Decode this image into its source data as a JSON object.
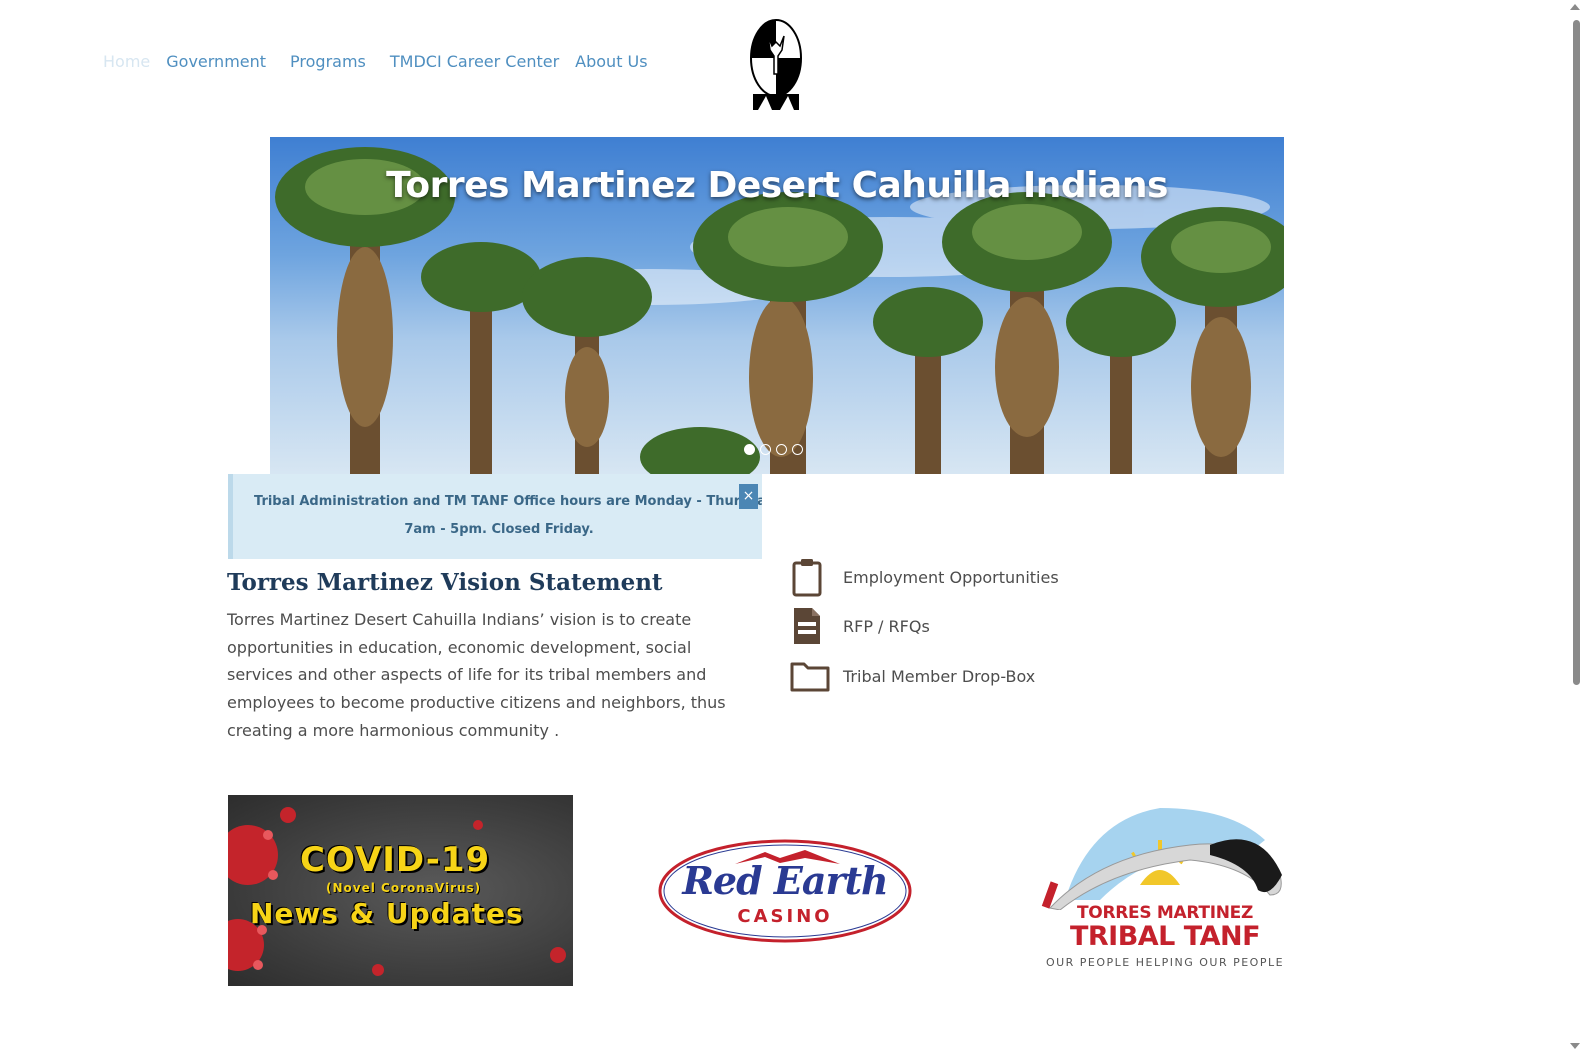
{
  "nav": {
    "items": [
      {
        "label": "Home"
      },
      {
        "label": "Government"
      },
      {
        "label": "Programs"
      },
      {
        "label": "TMDCI Career Center"
      },
      {
        "label": "About Us"
      }
    ]
  },
  "hero": {
    "title": "Torres Martinez Desert Cahuilla Indians",
    "slides_count": 4,
    "active_slide": 1
  },
  "notice": {
    "line1": "Tribal Administration and TM TANF Office hours are Monday - Thursday",
    "line2": "7am - 5pm. Closed Friday.",
    "close_label": "×"
  },
  "vision": {
    "title": "Torres Martinez Vision Statement",
    "body": "Torres Martinez Desert Cahuilla Indians’ vision is to create opportunities in education, economic development, social services and other aspects of life for its tribal members and employees to become productive citizens and neighbors, thus creating a more harmonious community ."
  },
  "quick_links": [
    {
      "label": "Employment Opportunities",
      "icon": "clipboard-icon"
    },
    {
      "label": "RFP / RFQs",
      "icon": "document-icon"
    },
    {
      "label": "Tribal Member Drop-Box",
      "icon": "folder-icon"
    }
  ],
  "cards": {
    "covid": {
      "line1": "COVID-19",
      "line2": "(Novel CoronaVirus)",
      "line3": "News & Updates"
    },
    "red_earth": {
      "script": "Red Earth",
      "word": "CASINO"
    },
    "tanf": {
      "line1": "TORRES MARTINEZ",
      "line2": "TRIBAL TANF",
      "line3": "OUR PEOPLE HELPING OUR PEOPLE"
    }
  },
  "colors": {
    "nav_link": "#4f8fc0",
    "notice_bg": "#d9ebf5",
    "icon_brown": "#5b4636",
    "vision_title": "#1f3b5a"
  }
}
